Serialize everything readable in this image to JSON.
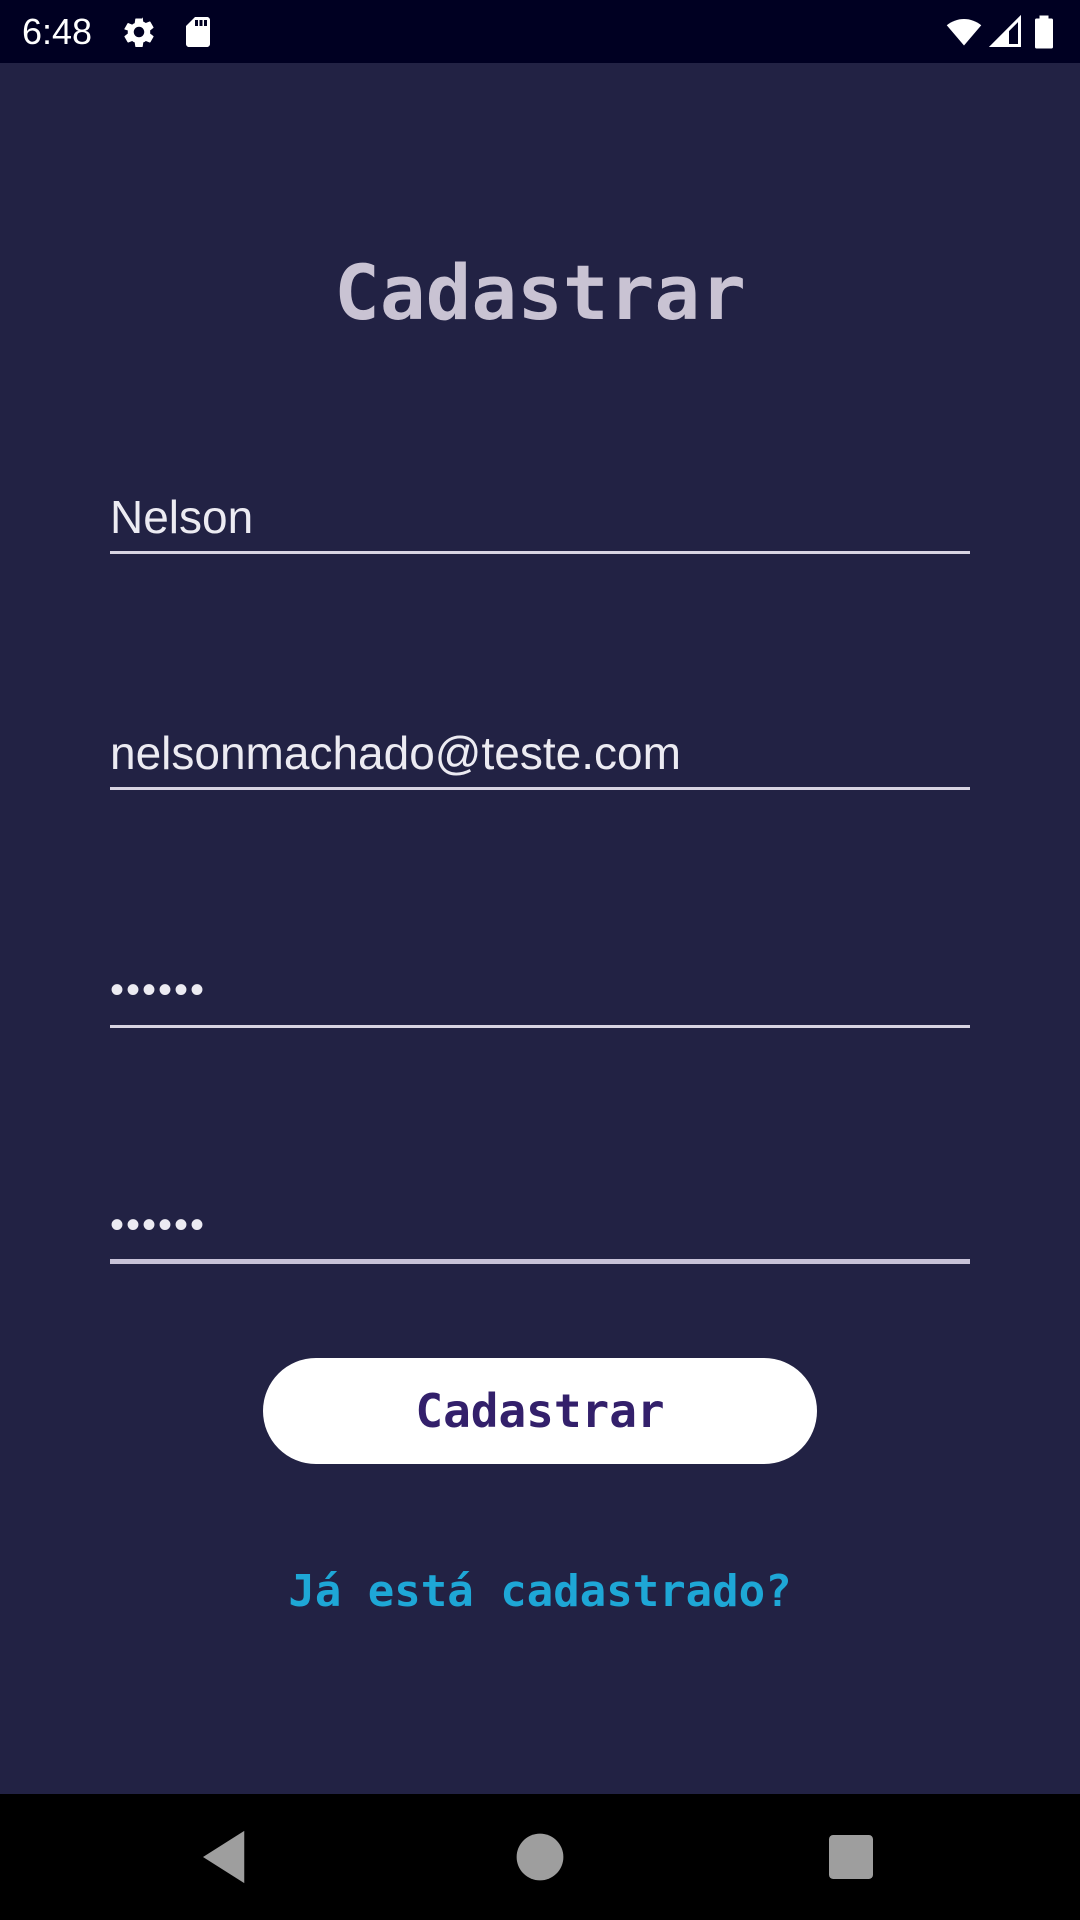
{
  "status_bar": {
    "time": "6:48",
    "icons": [
      "gear-icon",
      "sd-card-icon",
      "wifi-icon",
      "signal-icon",
      "battery-icon"
    ]
  },
  "form": {
    "title": "Cadastrar",
    "name_value": "Nelson",
    "email_value": "nelsonmachado@teste.com",
    "password_value": "••••••",
    "confirm_password_value": "••••••",
    "submit_label": "Cadastrar",
    "login_link": "Já está cadastrado?"
  },
  "navigation": {
    "buttons": [
      "back-icon",
      "home-icon",
      "recents-icon"
    ]
  },
  "colors": {
    "background": "#222244",
    "status_bar": "#000022",
    "title": "#c9c3d3",
    "button_bg": "#ffffff",
    "button_text": "#33206b",
    "link": "#1ea7d6"
  }
}
